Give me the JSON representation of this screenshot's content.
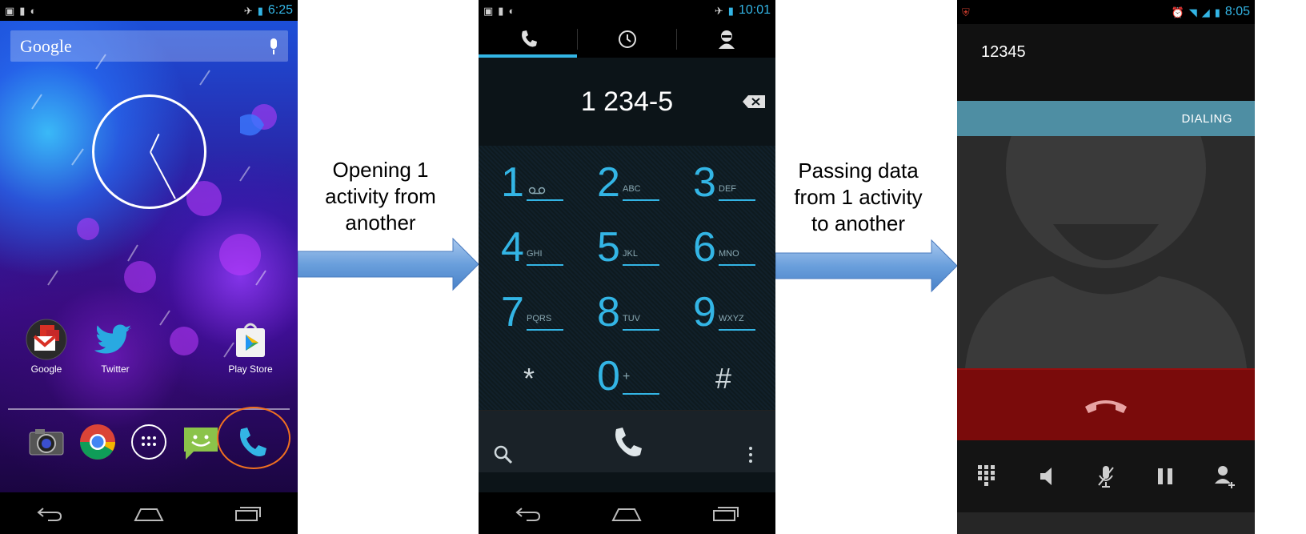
{
  "phone1": {
    "status_time": "6:25",
    "search_label": "Google",
    "apps": [
      {
        "label": "Google"
      },
      {
        "label": "Twitter"
      },
      {
        "label": "Play Store"
      }
    ]
  },
  "caption1": {
    "lines": [
      "Opening 1",
      "activity from",
      "another"
    ]
  },
  "phone2": {
    "status_time": "10:01",
    "dialed_digits": "1 234-5",
    "keys": [
      {
        "num": "1",
        "letters": ""
      },
      {
        "num": "2",
        "letters": "ABC"
      },
      {
        "num": "3",
        "letters": "DEF"
      },
      {
        "num": "4",
        "letters": "GHI"
      },
      {
        "num": "5",
        "letters": "JKL"
      },
      {
        "num": "6",
        "letters": "MNO"
      },
      {
        "num": "7",
        "letters": "PQRS"
      },
      {
        "num": "8",
        "letters": "TUV"
      },
      {
        "num": "9",
        "letters": "WXYZ"
      },
      {
        "num": "*",
        "letters": ""
      },
      {
        "num": "0",
        "letters": "+"
      },
      {
        "num": "#",
        "letters": ""
      }
    ]
  },
  "caption2": {
    "lines": [
      "Passing data",
      "from 1 activity",
      "to another"
    ]
  },
  "phone3": {
    "status_time": "8:05",
    "number": "12345",
    "state": "DIALING"
  },
  "colors": {
    "accent": "#33b5e5",
    "arrow": "#5b9bd5",
    "end_call": "#7a0b0b",
    "highlight": "#f07020"
  },
  "icons": [
    "camera-icon",
    "chrome-icon",
    "app-drawer-icon",
    "messaging-icon",
    "phone-icon",
    "back-icon",
    "home-icon",
    "recents-icon",
    "voicemail-icon",
    "search-icon",
    "overflow-icon",
    "backspace-icon",
    "call-icon",
    "call-log-icon",
    "contacts-icon",
    "dialpad-icon",
    "speaker-icon",
    "mute-icon",
    "hold-icon",
    "add-call-icon",
    "end-call-icon"
  ]
}
